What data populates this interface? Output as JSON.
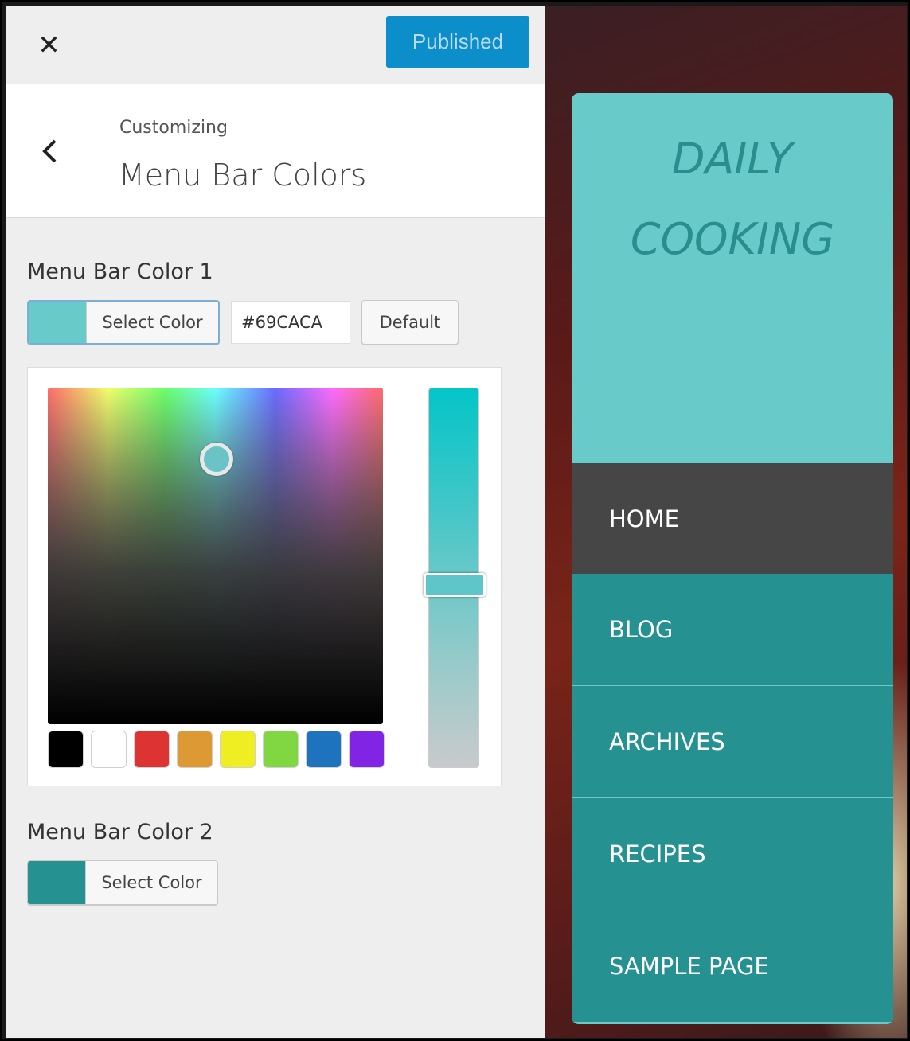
{
  "topbar": {
    "close_icon": "close-icon",
    "publish_label": "Published"
  },
  "header": {
    "back_icon": "chevron-left-icon",
    "eyebrow": "Customizing",
    "title": "Menu Bar Colors"
  },
  "color1": {
    "label": "Menu Bar Color 1",
    "swatch_color": "#69CACA",
    "select_label": "Select Color",
    "hex_value": "#69CACA",
    "default_label": "Default",
    "palette": [
      "#000000",
      "#ffffff",
      "#dd3333",
      "#dd9933",
      "#eeee22",
      "#81d742",
      "#1e73be",
      "#8224e3"
    ]
  },
  "color2": {
    "label": "Menu Bar Color 2",
    "swatch_color": "#269191",
    "select_label": "Select Color"
  },
  "preview": {
    "site_title_line1": "DAILY",
    "site_title_line2": "COOKING",
    "menu_color1": "#69CACA",
    "menu_color2": "#269191",
    "nav": [
      {
        "label": "HOME",
        "active": true
      },
      {
        "label": "BLOG",
        "active": false
      },
      {
        "label": "ARCHIVES",
        "active": false
      },
      {
        "label": "RECIPES",
        "active": false
      },
      {
        "label": "SAMPLE PAGE",
        "active": false
      }
    ]
  }
}
